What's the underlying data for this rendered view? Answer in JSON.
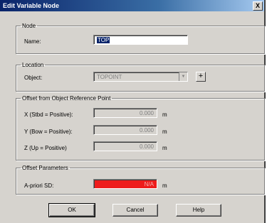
{
  "window": {
    "title": "Edit Variable Node",
    "close_glyph": "X"
  },
  "node": {
    "legend": "Node",
    "name_label": "Name:",
    "name_value": "TOP"
  },
  "location": {
    "legend": "Location",
    "object_label": "Object:",
    "object_value": "TOPOINT",
    "add_glyph": "+"
  },
  "offset": {
    "legend": "Offset from Object Reference Point",
    "rows": [
      {
        "label": "X  (Stbd = Positive):",
        "value": "0.000",
        "unit": "m"
      },
      {
        "label": "Y  (Bow = Positive):",
        "value": "0.000",
        "unit": "m"
      },
      {
        "label": "Z  (Up = Positive)",
        "value": "0.000",
        "unit": "m"
      }
    ]
  },
  "params": {
    "legend": "Offset Parameters",
    "sd_label": "A-priori SD:",
    "sd_value": "N/A",
    "sd_unit": "m",
    "sd_color": "#ee1c1c"
  },
  "buttons": {
    "ok": "OK",
    "cancel": "Cancel",
    "help": "Help"
  }
}
